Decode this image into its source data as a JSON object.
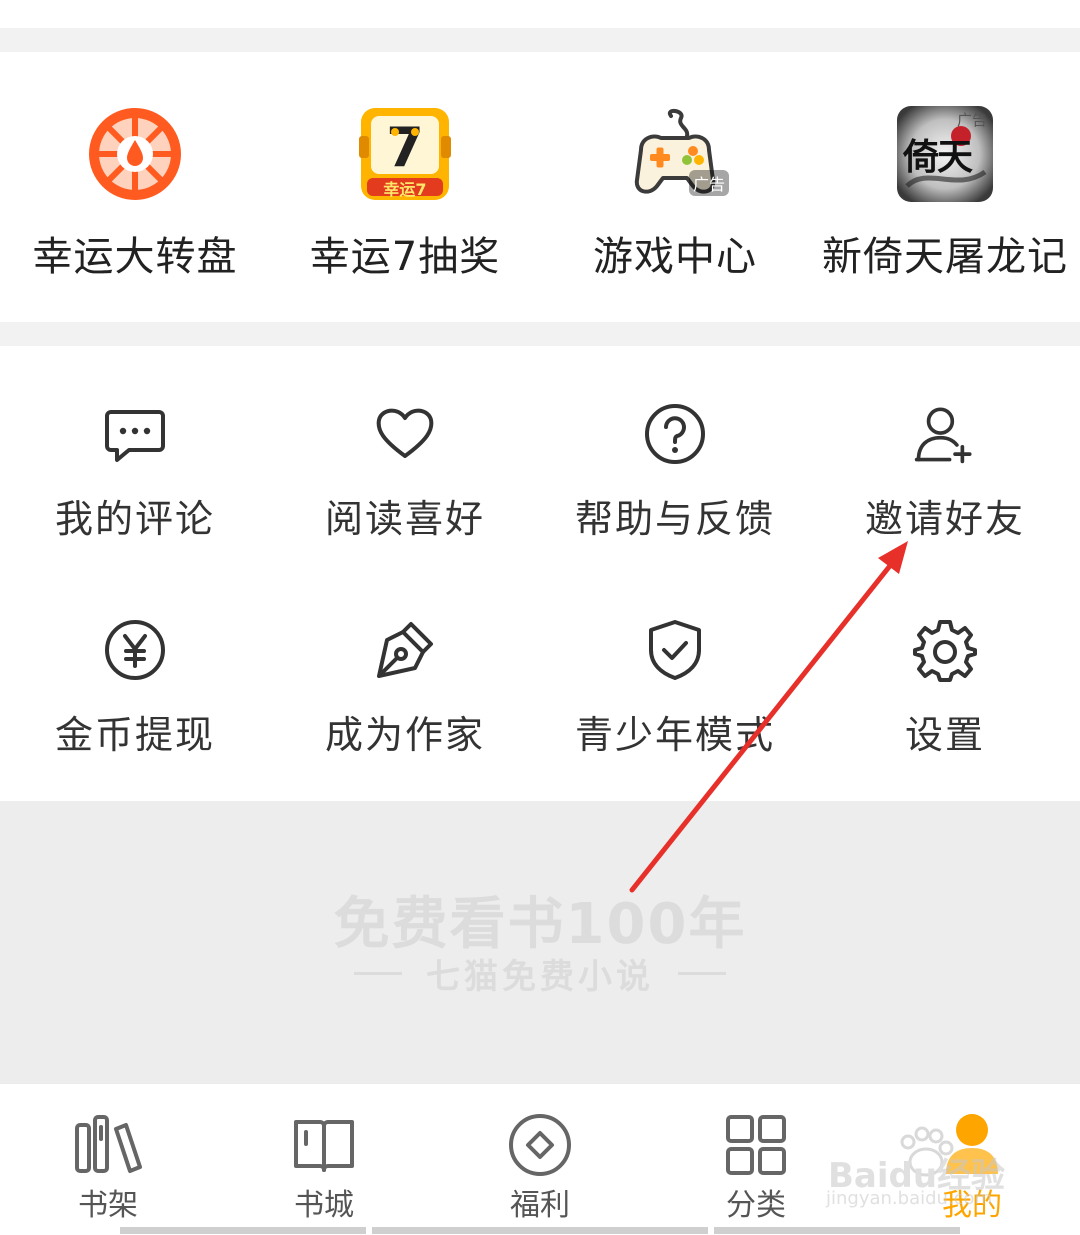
{
  "apps": [
    {
      "label": "幸运大转盘",
      "icon": "lucky-wheel-icon"
    },
    {
      "label": "幸运7抽奖",
      "icon": "lucky-seven-icon",
      "icon_text": "幸运7"
    },
    {
      "label": "游戏中心",
      "icon": "gamepad-icon",
      "badge": "广告"
    },
    {
      "label": "新倚天屠龙记",
      "icon": "game-cover-icon",
      "badge": "广告",
      "icon_text": "倚天"
    }
  ],
  "tools_row1": [
    {
      "label": "我的评论",
      "icon": "comment-icon"
    },
    {
      "label": "阅读喜好",
      "icon": "heart-icon"
    },
    {
      "label": "帮助与反馈",
      "icon": "help-icon"
    },
    {
      "label": "邀请好友",
      "icon": "add-user-icon"
    }
  ],
  "tools_row2": [
    {
      "label": "金币提现",
      "icon": "yuan-coin-icon"
    },
    {
      "label": "成为作家",
      "icon": "pen-icon"
    },
    {
      "label": "青少年模式",
      "icon": "shield-check-icon"
    },
    {
      "label": "设置",
      "icon": "gear-icon"
    }
  ],
  "promo": {
    "title": "免费看书100年",
    "subtitle": "七猫免费小说"
  },
  "tabs": [
    {
      "label": "书架",
      "icon": "bookshelf-icon"
    },
    {
      "label": "书城",
      "icon": "book-icon"
    },
    {
      "label": "福利",
      "icon": "gift-diamond-icon"
    },
    {
      "label": "分类",
      "icon": "grid-icon"
    },
    {
      "label": "我的",
      "icon": "profile-icon",
      "active": true
    }
  ],
  "watermark": {
    "text": "Baidu经验",
    "sub": "jingyan.baidu.com"
  },
  "colors": {
    "accent": "#ffa500",
    "annotation_arrow": "#e8302a",
    "lucky_wheel": "#ff5a1f"
  }
}
